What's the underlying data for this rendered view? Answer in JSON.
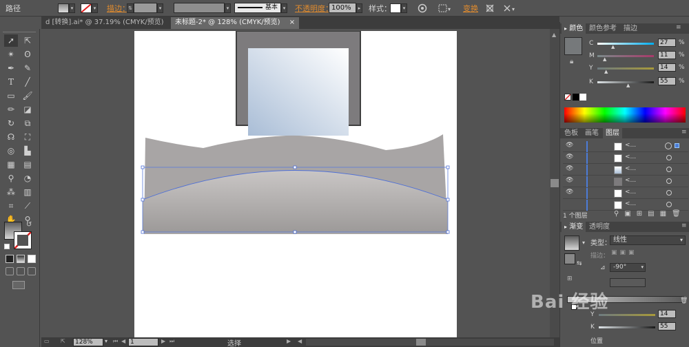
{
  "control_bar": {
    "object_type": "路径",
    "stroke_label": "描边：",
    "stroke_profile": "基本",
    "opacity_label": "不透明度：",
    "opacity_value": "100%",
    "style_label": "样式：",
    "transform_label": "变换"
  },
  "doc_tabs": [
    {
      "label": "d [转换].ai* @ 37.19% (CMYK/预览)",
      "close": "×"
    },
    {
      "label": "未标题-2* @ 128% (CMYK/预览)",
      "close": "×"
    }
  ],
  "color_panel": {
    "tabs": [
      "颜色",
      "颜色参考",
      "描边"
    ],
    "channels": [
      {
        "name": "C",
        "value": "27"
      },
      {
        "name": "M",
        "value": "11"
      },
      {
        "name": "Y",
        "value": "14"
      },
      {
        "name": "K",
        "value": "55"
      }
    ],
    "unit": "%"
  },
  "layers_panel": {
    "tabs": [
      "色板",
      "画笔",
      "图层"
    ],
    "rows": [
      "<...",
      "<...",
      "<...",
      "<...",
      "<...",
      "<..."
    ],
    "footer": "1 个图层"
  },
  "gradient_panel": {
    "tabs": [
      "渐变",
      "透明度"
    ],
    "type_label": "类型：",
    "type_value": "线性",
    "stroke_label": "描边：",
    "angle_value": "-90°",
    "y_value": "14",
    "k_value": "55",
    "pos_label": "位置",
    "y_label": "Y",
    "k_label": "K"
  },
  "status_bar": {
    "zoom": "128%",
    "artboard": "1",
    "mode": "选择"
  },
  "watermark": "Bai 经验"
}
